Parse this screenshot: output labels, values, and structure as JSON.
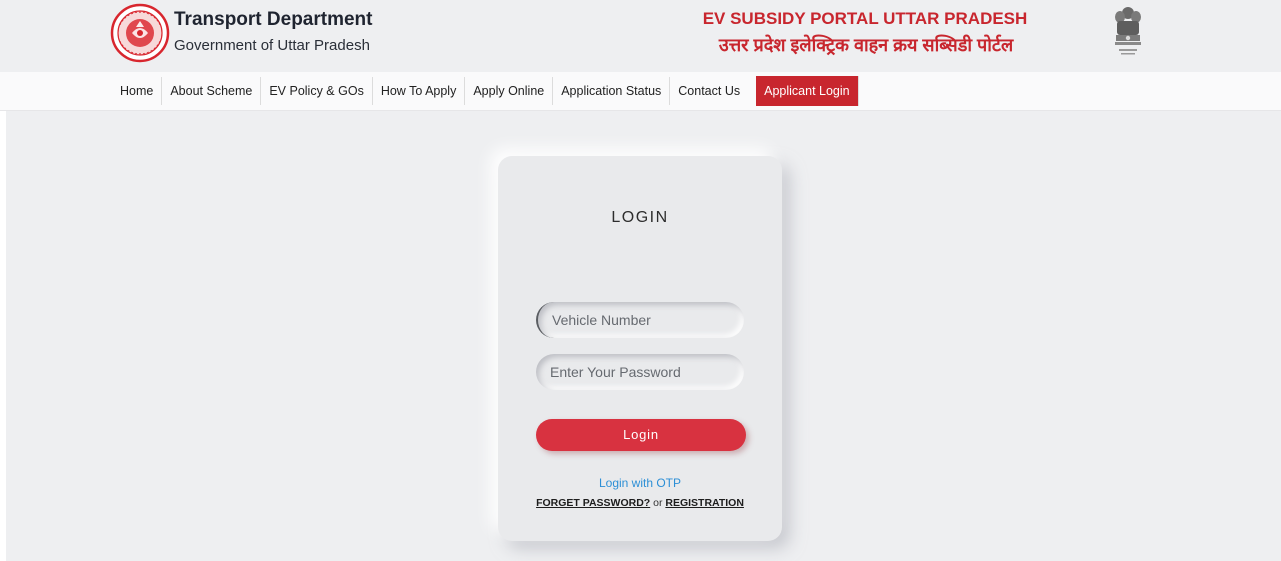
{
  "header": {
    "brand_title": "Transport Department",
    "brand_subtitle": "Government of Uttar Pradesh",
    "portal_title_en": "EV SUBSIDY PORTAL UTTAR PRADESH",
    "portal_title_hi": "उत्तर प्रदेश इलेक्ट्रिक वाहन क्रय सब्सिडी पोर्टल",
    "logo_icon": "up-state-seal-icon",
    "emblem_icon": "national-emblem-icon"
  },
  "nav": {
    "items": [
      {
        "label": "Home"
      },
      {
        "label": "About Scheme"
      },
      {
        "label": "EV Policy & GOs"
      },
      {
        "label": "How To Apply"
      },
      {
        "label": "Apply Online"
      },
      {
        "label": "Application Status"
      },
      {
        "label": "Contact Us"
      }
    ],
    "active": {
      "label": "Applicant Login"
    }
  },
  "login": {
    "title": "LOGIN",
    "vehicle_placeholder": "Vehicle Number",
    "password_placeholder": "Enter Your Password",
    "button_label": "Login",
    "otp_link": "Login with OTP",
    "forget_link": "FORGET PASSWORD?",
    "or_text": " or ",
    "registration_link": "REGISTRATION"
  },
  "colors": {
    "accent": "#c8262e",
    "button": "#d83240",
    "link": "#2c8fd6",
    "background": "#eeeff1"
  }
}
